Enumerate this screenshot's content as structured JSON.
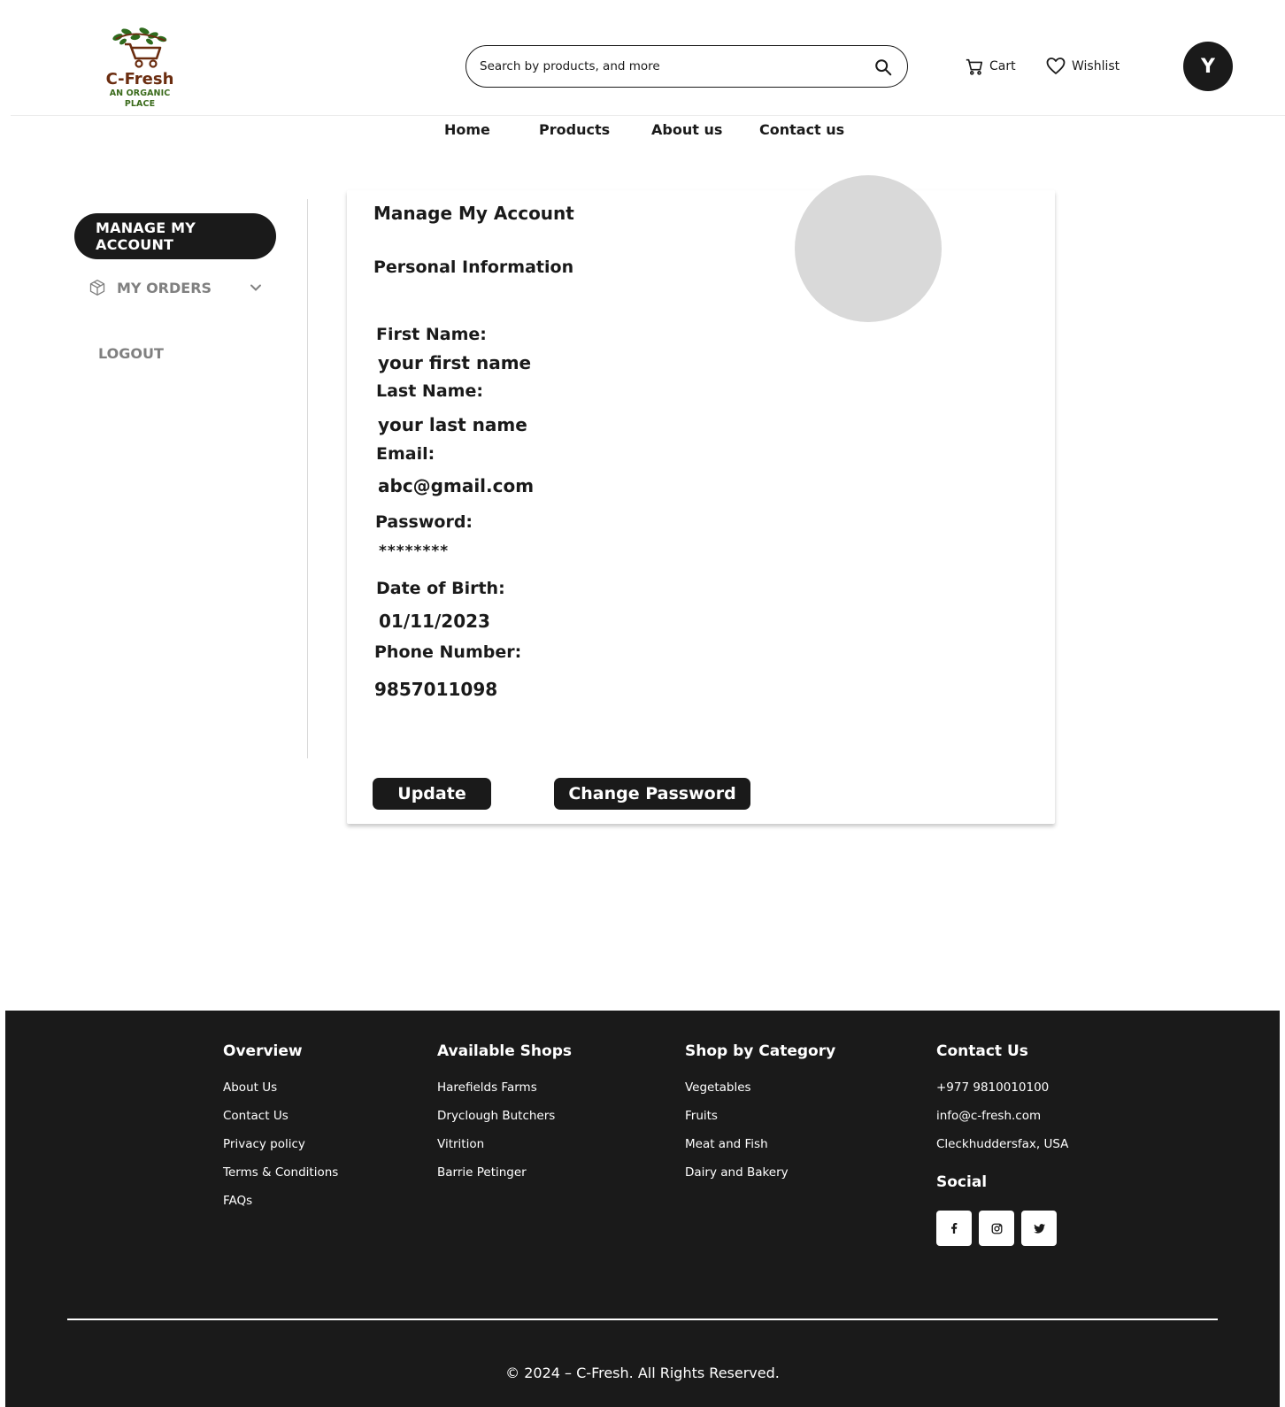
{
  "brand": {
    "name": "C-Fresh",
    "tagline": "AN ORGANIC PLACE"
  },
  "search": {
    "placeholder": "Search by products, and more"
  },
  "header": {
    "cart_label": "Cart",
    "wishlist_label": "Wishlist",
    "avatar_initial": "Y"
  },
  "nav": {
    "items": [
      "Home",
      "Products",
      "About us",
      "Contact us"
    ]
  },
  "sidebar": {
    "manage_account": "MANAGE MY ACCOUNT",
    "my_orders": "MY ORDERS",
    "logout": "LOGOUT"
  },
  "account": {
    "title": "Manage My Account",
    "subtitle": "Personal Information",
    "fields": [
      {
        "label": "First Name:",
        "value": "your first name"
      },
      {
        "label": "Last Name:",
        "value": "your last name"
      },
      {
        "label": "Email:",
        "value": "abc@gmail.com"
      },
      {
        "label": "Password:",
        "value": "********"
      },
      {
        "label": "Date of Birth:",
        "value": "01/11/2023"
      },
      {
        "label": "Phone Number:",
        "value": "9857011098"
      }
    ],
    "update_button": "Update",
    "change_password_button": "Change Password"
  },
  "footer": {
    "overview": {
      "title": "Overview",
      "links": [
        "About Us",
        "Contact Us",
        "Privacy policy",
        "Terms & Conditions",
        "FAQs"
      ]
    },
    "shops": {
      "title": "Available Shops",
      "links": [
        "Harefields Farms",
        "Dryclough Butchers",
        "Vitrition",
        "Barrie Petinger"
      ]
    },
    "categories": {
      "title": "Shop by Category",
      "links": [
        "Vegetables",
        "Fruits",
        "Meat and Fish",
        "Dairy and Bakery"
      ]
    },
    "contact": {
      "title": "Contact Us",
      "phone": "+977 9810010100",
      "email": "info@c-fresh.com",
      "address": "Cleckhuddersfax, USA"
    },
    "social": {
      "title": "Social",
      "icons": [
        "facebook-icon",
        "instagram-icon",
        "twitter-icon"
      ]
    },
    "copyright": "© 2024 – C-Fresh. All Rights Reserved."
  },
  "colors": {
    "dark": "#1a1a1a",
    "muted": "#808080",
    "brand_brown": "#6b2d10",
    "brand_green": "#3b6b1c",
    "photo_placeholder": "#d9d9d9"
  }
}
